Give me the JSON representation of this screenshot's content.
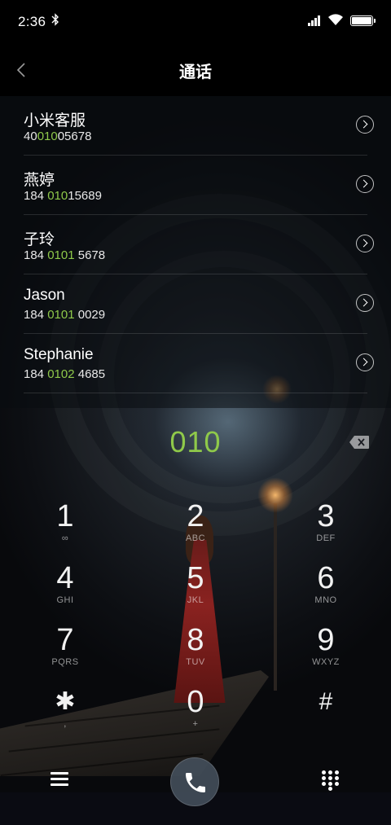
{
  "status_bar": {
    "time": "2:36",
    "icons": [
      "bluetooth-icon",
      "signal-icon",
      "wifi-icon",
      "battery-icon"
    ]
  },
  "header": {
    "back_icon": "chevron-left-icon",
    "title": "通话"
  },
  "results": [
    {
      "name": "小米客服",
      "number_pre": "40",
      "number_match": "010",
      "number_post": "05678"
    },
    {
      "name": "燕婷",
      "number_pre": "184 ",
      "number_match": "010",
      "number_post": "15689"
    },
    {
      "name": "子玲",
      "number_pre": "184 ",
      "number_match": "0101",
      "number_post": " 5678"
    },
    {
      "name": "Jason",
      "number_pre": "184 ",
      "number_match": "0101",
      "number_post": " 0029"
    },
    {
      "name": "Stephanie",
      "number_pre": "184 ",
      "number_match": "0102",
      "number_post": " 4685"
    }
  ],
  "dialer": {
    "typed_digits": "010",
    "highlight_color": "#8fc94a"
  },
  "keypad": {
    "keys": [
      {
        "digit": "1",
        "letters": "∞"
      },
      {
        "digit": "2",
        "letters": "ABC"
      },
      {
        "digit": "3",
        "letters": "DEF"
      },
      {
        "digit": "4",
        "letters": "GHI"
      },
      {
        "digit": "5",
        "letters": "JKL"
      },
      {
        "digit": "6",
        "letters": "MNO"
      },
      {
        "digit": "7",
        "letters": "PQRS"
      },
      {
        "digit": "8",
        "letters": "TUV"
      },
      {
        "digit": "9",
        "letters": "WXYZ"
      },
      {
        "digit": "✱",
        "letters": ","
      },
      {
        "digit": "0",
        "letters": "+"
      },
      {
        "digit": "#",
        "letters": ""
      }
    ]
  },
  "bottom_bar": {
    "icons": [
      "menu-icon",
      "phone-icon",
      "dialpad-icon"
    ]
  }
}
